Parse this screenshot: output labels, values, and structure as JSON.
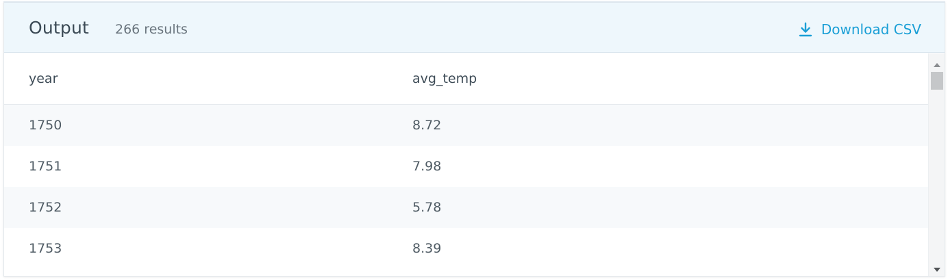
{
  "header": {
    "title": "Output",
    "result_count": "266 results",
    "download_label": "Download CSV"
  },
  "colors": {
    "accent": "#1a9fd6",
    "header_bg": "#eef7fc",
    "stripe": "#f7f9fb"
  },
  "table": {
    "columns": [
      "year",
      "avg_temp"
    ],
    "rows": [
      [
        "1750",
        "8.72"
      ],
      [
        "1751",
        "7.98"
      ],
      [
        "1752",
        "5.78"
      ],
      [
        "1753",
        "8.39"
      ]
    ]
  },
  "icons": {
    "download": "download-icon",
    "scroll_up": "chevron-up-icon",
    "scroll_down": "chevron-down-icon"
  }
}
